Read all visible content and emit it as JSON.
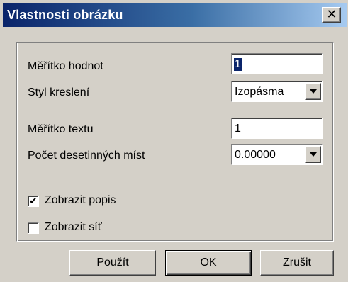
{
  "window": {
    "title": "Vlastnosti obrázku",
    "close_glyph": "✕"
  },
  "form": {
    "value_scale": {
      "label": "Měřítko hodnot",
      "value": "1"
    },
    "draw_style": {
      "label": "Styl kreslení",
      "value": "Izopásma"
    },
    "text_scale": {
      "label": "Měřítko textu",
      "value": "1"
    },
    "decimals": {
      "label": "Počet desetinných míst",
      "value": "0.00000"
    },
    "show_description": {
      "label": "Zobrazit popis",
      "checked": true,
      "mark": "✔"
    },
    "show_grid": {
      "label": "Zobrazit síť",
      "checked": false,
      "mark": ""
    }
  },
  "buttons": {
    "apply": "Použít",
    "ok": "OK",
    "cancel": "Zrušit"
  }
}
